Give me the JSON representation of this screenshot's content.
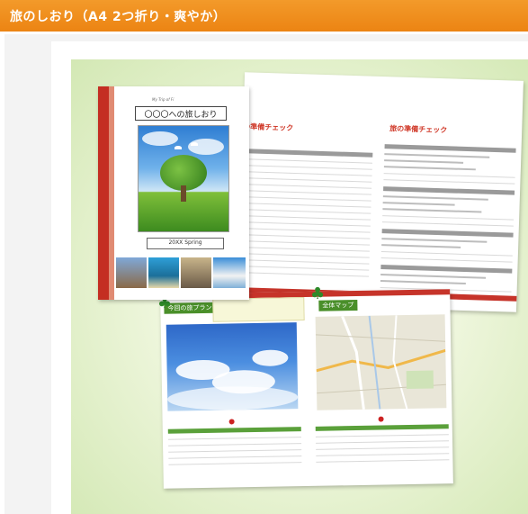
{
  "header": {
    "title": "旅のしおり（A4 2つ折り・爽やか）"
  },
  "preview": {
    "cover": {
      "subtitle": "My Trip of Fi",
      "title": "〇〇〇への旅しおり",
      "date": "20XX  Spring"
    },
    "back_pages": {
      "left_title": "の準備チェック",
      "right_title": "旅の準備チェック"
    },
    "front_pages": {
      "left_tag": "今回の旅プラン",
      "right_tag": "全体マップ"
    }
  },
  "colors": {
    "header": "#ec8413",
    "accent_red": "#c6342a",
    "accent_green": "#4a8f2a"
  }
}
